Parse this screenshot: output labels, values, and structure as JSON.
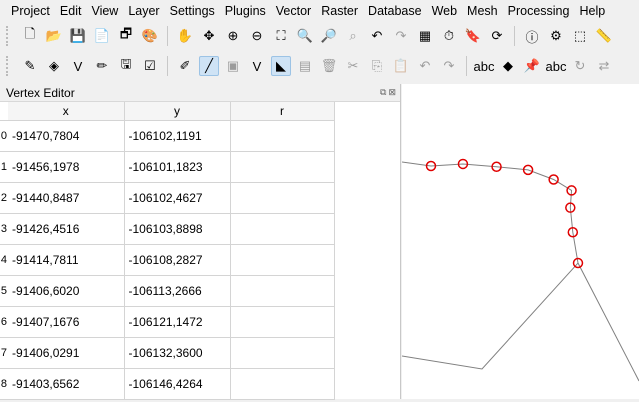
{
  "menu": [
    "Project",
    "Edit",
    "View",
    "Layer",
    "Settings",
    "Plugins",
    "Vector",
    "Raster",
    "Database",
    "Web",
    "Mesh",
    "Processing",
    "Help"
  ],
  "toolbar1": [
    {
      "name": "new-project-icon",
      "glyph": "🗋",
      "enabled": true
    },
    {
      "name": "open-project-icon",
      "glyph": "📂",
      "enabled": true
    },
    {
      "name": "save-project-icon",
      "glyph": "💾",
      "enabled": true
    },
    {
      "name": "new-print-layout-icon",
      "glyph": "📄",
      "enabled": true
    },
    {
      "name": "show-layout-manager-icon",
      "glyph": "🗗",
      "enabled": true
    },
    {
      "name": "style-manager-icon",
      "glyph": "🎨",
      "enabled": true
    },
    {
      "name": "sep",
      "glyph": "",
      "enabled": true
    },
    {
      "name": "pan-icon",
      "glyph": "✋",
      "enabled": true
    },
    {
      "name": "pan-to-selection-icon",
      "glyph": "✥",
      "enabled": true
    },
    {
      "name": "zoom-in-icon",
      "glyph": "⊕",
      "enabled": true
    },
    {
      "name": "zoom-out-icon",
      "glyph": "⊖",
      "enabled": true
    },
    {
      "name": "zoom-full-icon",
      "glyph": "⛶",
      "enabled": true
    },
    {
      "name": "zoom-to-selection-icon",
      "glyph": "🔍",
      "enabled": true
    },
    {
      "name": "zoom-to-layer-icon",
      "glyph": "🔎",
      "enabled": true
    },
    {
      "name": "zoom-native-icon",
      "glyph": "⌕",
      "enabled": false
    },
    {
      "name": "zoom-last-icon",
      "glyph": "↶",
      "enabled": true
    },
    {
      "name": "zoom-next-icon",
      "glyph": "↷",
      "enabled": false
    },
    {
      "name": "new-map-view-icon",
      "glyph": "▦",
      "enabled": true
    },
    {
      "name": "temporal-controller-icon",
      "glyph": "⏱",
      "enabled": true
    },
    {
      "name": "bookmark-icon",
      "glyph": "🔖",
      "enabled": true
    },
    {
      "name": "refresh-icon",
      "glyph": "⟳",
      "enabled": true
    },
    {
      "name": "sep",
      "glyph": "",
      "enabled": true
    },
    {
      "name": "identify-icon",
      "glyph": "ⓘ",
      "enabled": true
    },
    {
      "name": "attribute-table-icon",
      "glyph": "⚙",
      "enabled": true
    },
    {
      "name": "select-features-icon",
      "glyph": "⬚",
      "enabled": true
    },
    {
      "name": "measure-icon",
      "glyph": "📏",
      "enabled": true
    }
  ],
  "toolbar2": [
    {
      "name": "current-edits-icon",
      "glyph": "✎",
      "enabled": true,
      "active": false
    },
    {
      "name": "layer-diagram-icon",
      "glyph": "◈",
      "enabled": true,
      "active": false
    },
    {
      "name": "digitize-vector-icon",
      "glyph": "V",
      "enabled": true,
      "active": false
    },
    {
      "name": "toggle-editing-icon",
      "glyph": "✏",
      "enabled": true,
      "active": false
    },
    {
      "name": "save-edits-icon",
      "glyph": "🖫",
      "enabled": true,
      "active": false
    },
    {
      "name": "vertex-editor-icon",
      "glyph": "☑",
      "enabled": true,
      "active": false
    },
    {
      "name": "sep",
      "glyph": "",
      "enabled": true,
      "active": false
    },
    {
      "name": "edit-pencil-icon",
      "glyph": "✐",
      "enabled": true,
      "active": false
    },
    {
      "name": "digitize-line-icon",
      "glyph": "╱",
      "enabled": true,
      "active": true
    },
    {
      "name": "add-feature-icon",
      "glyph": "▣",
      "enabled": false,
      "active": false
    },
    {
      "name": "vertex-tool-icon",
      "glyph": "V",
      "enabled": true,
      "active": false
    },
    {
      "name": "vertex-tool-dropdown-icon",
      "glyph": "◣",
      "enabled": true,
      "active": true
    },
    {
      "name": "modify-attributes-icon",
      "glyph": "▤",
      "enabled": false,
      "active": false
    },
    {
      "name": "delete-selected-icon",
      "glyph": "🗑",
      "enabled": false,
      "active": false
    },
    {
      "name": "cut-features-icon",
      "glyph": "✂",
      "enabled": false,
      "active": false
    },
    {
      "name": "copy-features-icon",
      "glyph": "⎘",
      "enabled": false,
      "active": false
    },
    {
      "name": "paste-features-icon",
      "glyph": "📋",
      "enabled": false,
      "active": false
    },
    {
      "name": "undo-icon",
      "glyph": "↶",
      "enabled": false,
      "active": false
    },
    {
      "name": "redo-icon",
      "glyph": "↷",
      "enabled": false,
      "active": false
    },
    {
      "name": "sep",
      "glyph": "",
      "enabled": true,
      "active": false
    },
    {
      "name": "label-icon",
      "glyph": "abc",
      "enabled": true,
      "active": false
    },
    {
      "name": "label-tool-icon",
      "glyph": "◆",
      "enabled": true,
      "active": false
    },
    {
      "name": "pin-labels-icon",
      "glyph": "📌",
      "enabled": true,
      "active": false
    },
    {
      "name": "highlight-labels-icon",
      "glyph": "abc",
      "enabled": true,
      "active": false
    },
    {
      "name": "rotate-label-icon",
      "glyph": "↻",
      "enabled": false,
      "active": false
    },
    {
      "name": "change-label-icon",
      "glyph": "⇄",
      "enabled": false,
      "active": false
    }
  ],
  "vertex_editor": {
    "title": "Vertex Editor",
    "columns": [
      "x",
      "y",
      "r"
    ],
    "rows": [
      {
        "index": "0",
        "x": "-91470,7804",
        "y": "-106102,1191",
        "r": ""
      },
      {
        "index": "1",
        "x": "-91456,1978",
        "y": "-106101,1823",
        "r": ""
      },
      {
        "index": "2",
        "x": "-91440,8487",
        "y": "-106102,4627",
        "r": ""
      },
      {
        "index": "3",
        "x": "-91426,4516",
        "y": "-106103,8898",
        "r": ""
      },
      {
        "index": "4",
        "x": "-91414,7811",
        "y": "-106108,2827",
        "r": ""
      },
      {
        "index": "5",
        "x": "-91406,6020",
        "y": "-106113,2666",
        "r": ""
      },
      {
        "index": "6",
        "x": "-91407,1676",
        "y": "-106121,1472",
        "r": ""
      },
      {
        "index": "7",
        "x": "-91406,0291",
        "y": "-106132,3600",
        "r": ""
      },
      {
        "index": "8",
        "x": "-91403,6562",
        "y": "-106146,4264",
        "r": ""
      }
    ]
  },
  "colors": {
    "vertex_marker": "#e00000",
    "line": "#808080",
    "selection_bg": "#cfe3f5"
  }
}
